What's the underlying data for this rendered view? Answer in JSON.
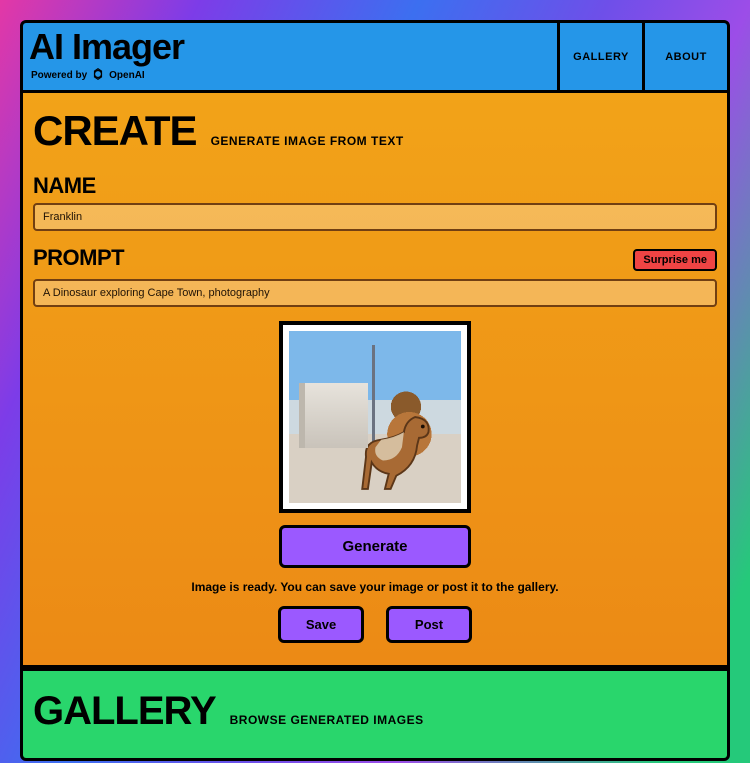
{
  "header": {
    "brand_title": "AI Imager",
    "powered_prefix": "Powered by",
    "powered_name": "OpenAI",
    "nav": {
      "gallery": "GALLERY",
      "about": "ABOUT"
    }
  },
  "create": {
    "title": "CREATE",
    "subtitle": "GENERATE IMAGE FROM TEXT",
    "name_label": "NAME",
    "name_value": "Franklin",
    "prompt_label": "PROMPT",
    "prompt_value": "A Dinosaur exploring Cape Town, photography",
    "surprise_label": "Surprise me",
    "generate_label": "Generate",
    "status_text": "Image is ready. You can save your image or post it to the gallery.",
    "save_label": "Save",
    "post_label": "Post"
  },
  "gallery": {
    "title": "GALLERY",
    "subtitle": "BROWSE GENERATED IMAGES"
  }
}
